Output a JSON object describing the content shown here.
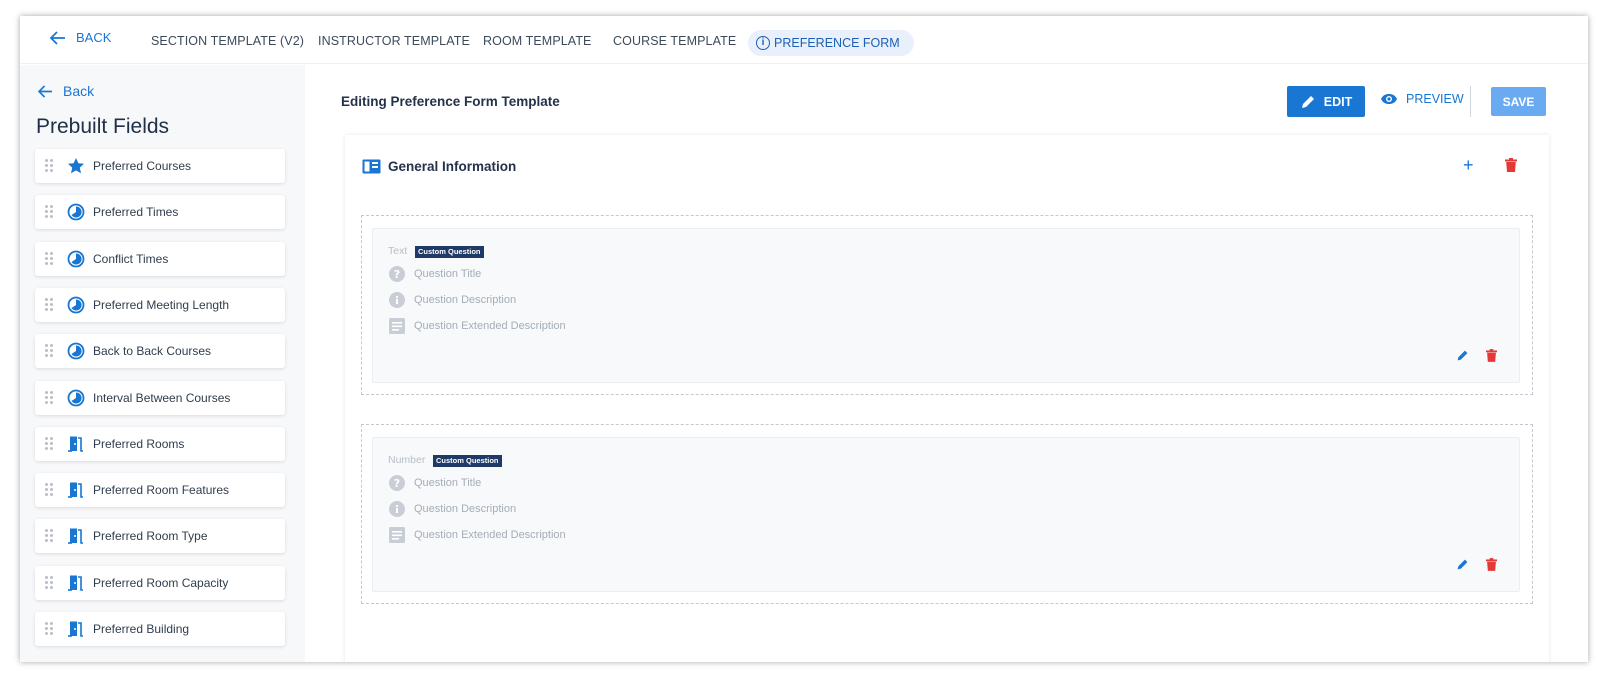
{
  "topnav": {
    "back_label": "BACK",
    "tabs": [
      {
        "label": "SECTION TEMPLATE (V2)"
      },
      {
        "label": "INSTRUCTOR TEMPLATE"
      },
      {
        "label": "ROOM TEMPLATE"
      },
      {
        "label": "COURSE TEMPLATE"
      }
    ],
    "active_tab": {
      "label": "PREFERENCE FORM",
      "icon": "info-icon"
    }
  },
  "sidebar": {
    "back_label": "Back",
    "title": "Prebuilt Fields",
    "items": [
      {
        "label": "Preferred Courses",
        "icon": "star-icon"
      },
      {
        "label": "Preferred Times",
        "icon": "clock-icon"
      },
      {
        "label": "Conflict Times",
        "icon": "clock-icon"
      },
      {
        "label": "Preferred Meeting Length",
        "icon": "clock-icon"
      },
      {
        "label": "Back to Back Courses",
        "icon": "clock-icon"
      },
      {
        "label": "Interval Between Courses",
        "icon": "clock-icon"
      },
      {
        "label": "Preferred Rooms",
        "icon": "door-icon"
      },
      {
        "label": "Preferred Room Features",
        "icon": "door-icon"
      },
      {
        "label": "Preferred Room Type",
        "icon": "door-icon"
      },
      {
        "label": "Preferred Room Capacity",
        "icon": "door-icon"
      },
      {
        "label": "Preferred Building",
        "icon": "door-icon"
      }
    ]
  },
  "main": {
    "title": "Editing Preference Form Template",
    "edit_label": "EDIT",
    "preview_label": "PREVIEW",
    "save_label": "SAVE",
    "section": {
      "title": "General Information",
      "add_label": "+",
      "questions": [
        {
          "type": "Text",
          "badge": "Custom Question",
          "title_placeholder": "Question Title",
          "description_placeholder": "Question Description",
          "extended_placeholder": "Question Extended Description"
        },
        {
          "type": "Number",
          "badge": "Custom Question",
          "title_placeholder": "Question Title",
          "description_placeholder": "Question Description",
          "extended_placeholder": "Question Extended Description"
        }
      ]
    }
  },
  "colors": {
    "primary": "#1976d2",
    "save_button": "#6aaaf0",
    "delete": "#e53935",
    "badge": "#1f3a66",
    "sidebar_bg": "#f7f8fa"
  }
}
